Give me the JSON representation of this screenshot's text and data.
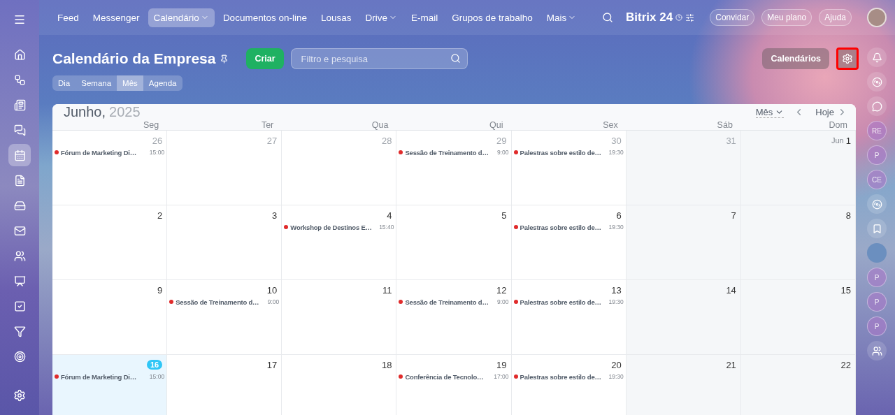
{
  "top_nav": {
    "items": [
      {
        "label": "Feed",
        "selected": false,
        "dropdown": false
      },
      {
        "label": "Messenger",
        "selected": false,
        "dropdown": false
      },
      {
        "label": "Calendário",
        "selected": true,
        "dropdown": true
      },
      {
        "label": "Documentos on-line",
        "selected": false,
        "dropdown": false
      },
      {
        "label": "Lousas",
        "selected": false,
        "dropdown": false
      },
      {
        "label": "Drive",
        "selected": false,
        "dropdown": true
      },
      {
        "label": "E-mail",
        "selected": false,
        "dropdown": false
      },
      {
        "label": "Grupos de trabalho",
        "selected": false,
        "dropdown": false
      },
      {
        "label": "Mais",
        "selected": false,
        "dropdown": true
      }
    ],
    "logo": {
      "name": "Bitrix",
      "number": "24"
    },
    "buttons": [
      "Convidar",
      "Meu plano",
      "Ajuda"
    ]
  },
  "left_sidebar": {
    "items": [
      {
        "selected": false
      },
      {
        "selected": false
      },
      {
        "selected": false
      },
      {
        "selected": false
      },
      {
        "selected": true
      },
      {
        "selected": false
      },
      {
        "selected": false
      },
      {
        "selected": false
      },
      {
        "selected": false
      },
      {
        "selected": false
      },
      {
        "selected": false
      },
      {
        "selected": false
      },
      {
        "selected": false
      }
    ]
  },
  "page": {
    "title": "Calendário da Empresa",
    "create_button": "Criar",
    "search": {
      "placeholder": "Filtro e pesquisa"
    },
    "calendars_button": "Calendários",
    "views": [
      {
        "label": "Dia",
        "selected": false
      },
      {
        "label": "Semana",
        "selected": false
      },
      {
        "label": "Mês",
        "selected": true
      },
      {
        "label": "Agenda",
        "selected": false
      }
    ]
  },
  "calendar": {
    "month": "Junho,",
    "year": "2025",
    "view_select": "Mês",
    "today_button": "Hoje",
    "weekdays": [
      "Seg",
      "Ter",
      "Qua",
      "Qui",
      "Sex",
      "Sáb",
      "Dom"
    ],
    "weeks": [
      {
        "days": [
          {
            "day": "26",
            "muted": true,
            "today": false,
            "events": [
              {
                "title": "Fórum de Marketing Di…",
                "time": "15:00",
                "color": "#e02b2b"
              }
            ]
          },
          {
            "day": "27",
            "muted": true,
            "today": false
          },
          {
            "day": "28",
            "muted": true,
            "today": false
          },
          {
            "day": "29",
            "muted": true,
            "today": false,
            "events": [
              {
                "title": "Sessão de Treinamento d…",
                "time": "9:00",
                "color": "#e02b2b"
              }
            ]
          },
          {
            "day": "30",
            "muted": true,
            "today": false,
            "events": [
              {
                "title": "Palestras sobre estilo de…",
                "time": "19:30",
                "color": "#e02b2b"
              }
            ]
          },
          {
            "day": "31",
            "muted": true,
            "today": false
          },
          {
            "day": "1",
            "prefix": "Jun",
            "muted": false,
            "today": false
          }
        ]
      },
      {
        "days": [
          {
            "day": "2",
            "muted": false,
            "today": false
          },
          {
            "day": "3",
            "muted": false,
            "today": false
          },
          {
            "day": "4",
            "muted": false,
            "today": false,
            "events": [
              {
                "title": "Workshop de Destinos E…",
                "time": "15:40",
                "color": "#e02b2b"
              }
            ]
          },
          {
            "day": "5",
            "muted": false,
            "today": false
          },
          {
            "day": "6",
            "muted": false,
            "today": false,
            "events": [
              {
                "title": "Palestras sobre estilo de…",
                "time": "19:30",
                "color": "#e02b2b"
              }
            ]
          },
          {
            "day": "7",
            "muted": false,
            "today": false
          },
          {
            "day": "8",
            "muted": false,
            "today": false
          }
        ]
      },
      {
        "days": [
          {
            "day": "9",
            "muted": false,
            "today": false
          },
          {
            "day": "10",
            "muted": false,
            "today": false,
            "events": [
              {
                "title": "Sessão de Treinamento d…",
                "time": "9:00",
                "color": "#e02b2b"
              }
            ]
          },
          {
            "day": "11",
            "muted": false,
            "today": false
          },
          {
            "day": "12",
            "muted": false,
            "today": false,
            "events": [
              {
                "title": "Sessão de Treinamento d…",
                "time": "9:00",
                "color": "#e02b2b"
              }
            ]
          },
          {
            "day": "13",
            "muted": false,
            "today": false,
            "events": [
              {
                "title": "Palestras sobre estilo de…",
                "time": "19:30",
                "color": "#e02b2b"
              }
            ]
          },
          {
            "day": "14",
            "muted": false,
            "today": false
          },
          {
            "day": "15",
            "muted": false,
            "today": false
          }
        ]
      },
      {
        "days": [
          {
            "day": "16",
            "muted": false,
            "today": true,
            "events": [
              {
                "title": "Fórum de Marketing Di…",
                "time": "15:00",
                "color": "#e02b2b"
              }
            ]
          },
          {
            "day": "17",
            "muted": false,
            "today": false
          },
          {
            "day": "18",
            "muted": false,
            "today": false
          },
          {
            "day": "19",
            "muted": false,
            "today": false,
            "events": [
              {
                "title": "Conferência de Tecnolo…",
                "time": "17:00",
                "color": "#e02b2b"
              }
            ]
          },
          {
            "day": "20",
            "muted": false,
            "today": false,
            "events": [
              {
                "title": "Palestras sobre estilo de…",
                "time": "19:30",
                "color": "#e02b2b"
              }
            ]
          },
          {
            "day": "21",
            "muted": false,
            "today": false
          },
          {
            "day": "22",
            "muted": false,
            "today": false
          }
        ]
      }
    ]
  },
  "right_sidebar": {
    "items": [
      {
        "kind": "icon"
      },
      {
        "kind": "icon"
      },
      {
        "kind": "icon"
      },
      {
        "kind": "avatar",
        "initials": "RE"
      },
      {
        "kind": "avatar",
        "initials": "P"
      },
      {
        "kind": "avatar",
        "initials": "CE"
      },
      {
        "kind": "icon"
      },
      {
        "kind": "icon"
      },
      {
        "kind": "photo"
      },
      {
        "kind": "avatar",
        "initials": "P"
      },
      {
        "kind": "avatar",
        "initials": "P"
      },
      {
        "kind": "avatar",
        "initials": "P"
      },
      {
        "kind": "icon"
      }
    ]
  }
}
